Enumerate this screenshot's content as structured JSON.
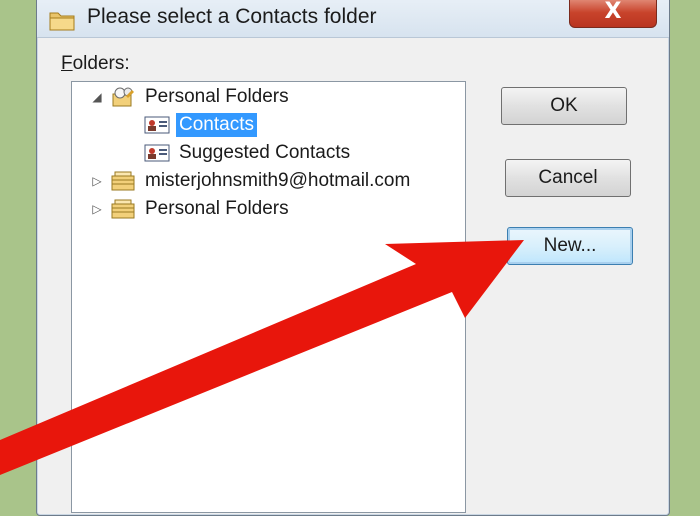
{
  "window": {
    "title": "Please select a Contacts folder",
    "close_glyph": "X"
  },
  "folders_label": {
    "underlined": "F",
    "rest": "olders:"
  },
  "tree": [
    {
      "label": "Personal Folders",
      "icon": "personal-folders-icon",
      "expanded": true
    },
    {
      "label": "Contacts",
      "icon": "contacts-card-icon",
      "selected": true
    },
    {
      "label": "Suggested Contacts",
      "icon": "contacts-card-icon"
    },
    {
      "label": "misterjohnsmith9@hotmail.com",
      "icon": "mailbox-folder-icon",
      "expanded": false
    },
    {
      "label": "Personal Folders",
      "icon": "mailbox-folder-icon",
      "expanded": false
    }
  ],
  "buttons": {
    "ok": "OK",
    "cancel": "Cancel",
    "new": "New..."
  },
  "colors": {
    "background": "#a9c48a",
    "selection": "#3399ff",
    "arrow": "#e8160c"
  }
}
